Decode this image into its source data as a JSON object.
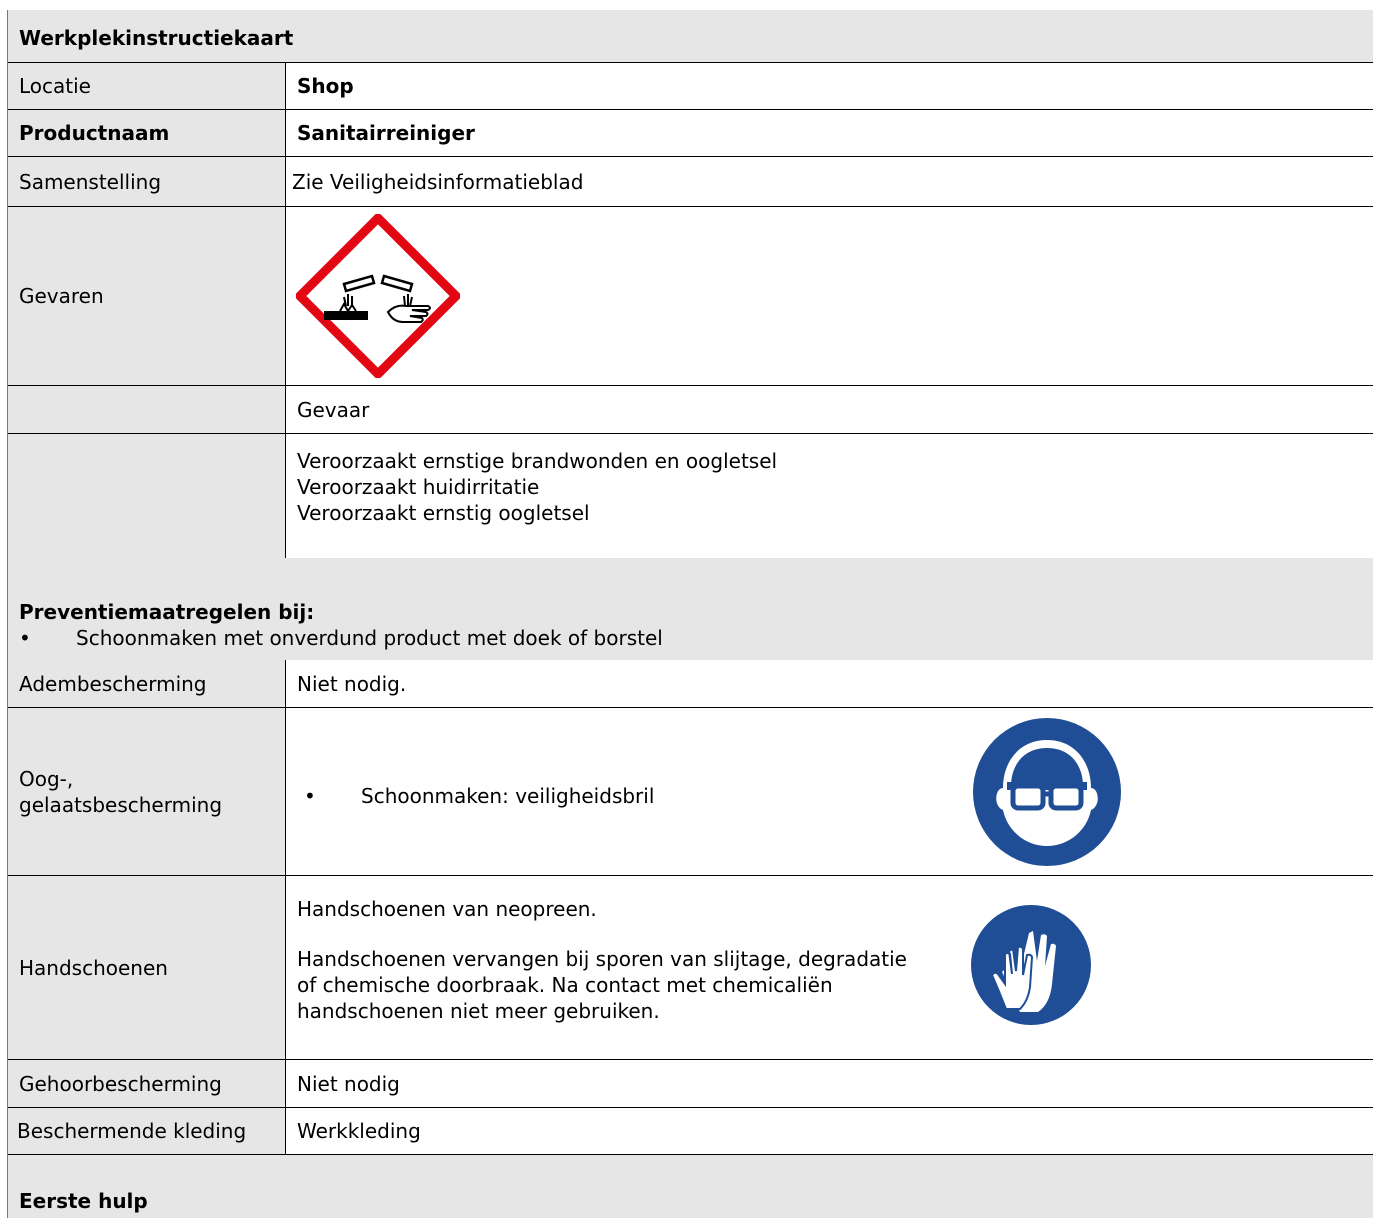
{
  "title": "Werkplekinstructiekaart",
  "rows": {
    "locatie": {
      "label": "Locatie",
      "value": "Shop"
    },
    "productnaam": {
      "label": "Productnaam",
      "value": "Sanitairreiniger"
    },
    "samenstelling": {
      "label": "Samenstelling",
      "value": "Zie Veiligheidsinformatieblad"
    },
    "gevaren": {
      "label": "Gevaren",
      "pictogram": "ghs-corrosive-icon"
    },
    "signaalwoord": {
      "value": "Gevaar"
    },
    "zinnen": {
      "lines": [
        "Veroorzaakt ernstige brandwonden en oogletsel",
        "Veroorzaakt huidirritatie",
        "Veroorzaakt ernstig oogletsel"
      ]
    }
  },
  "preventie": {
    "heading": "Preventiemaatregelen bij:",
    "bullet": "•",
    "item": "Schoonmaken met onverdund product met doek of borstel"
  },
  "pbm": {
    "adem": {
      "label": "Adembescherming",
      "value": "Niet nodig."
    },
    "oog": {
      "label_line1": "Oog-,",
      "label_line2": "gelaatsbescherming",
      "bullet": "•",
      "value": "Schoonmaken: veiligheidsbril",
      "icon": "safety-goggles-icon"
    },
    "handschoenen": {
      "label": "Handschoenen",
      "line1": "Handschoenen van neopreen.",
      "para": [
        "Handschoenen vervangen bij sporen van slijtage, degradatie",
        "of chemische doorbraak. Na contact met chemicaliën",
        "handschoenen niet meer gebruiken."
      ],
      "icon": "gloves-icon"
    },
    "gehoor": {
      "label": "Gehoorbescherming",
      "value": "Niet nodig"
    },
    "kleding": {
      "label": "Beschermende kleding",
      "value": "Werkkleding"
    }
  },
  "eerste_hulp": {
    "heading": "Eerste hulp"
  },
  "colors": {
    "grey_header": "#e7e6e6",
    "ghs_red": "#e30613",
    "mandatory_blue": "#1f4e96"
  }
}
